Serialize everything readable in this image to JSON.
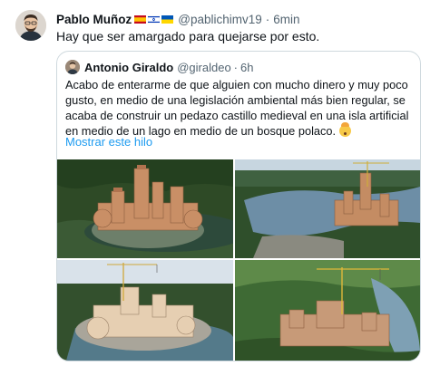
{
  "tweet": {
    "author_name": "Pablo Muñoz",
    "flags": [
      "spain-flag",
      "israel-flag",
      "ukraine-flag"
    ],
    "handle": "@pablichimv19",
    "separator": "·",
    "time": "6min",
    "text": "Hay que ser amargado para quejarse por esto."
  },
  "quote": {
    "author_name": "Antonio Giraldo",
    "handle": "@giraldeo",
    "separator": "·",
    "time": "6h",
    "text": "Acabo de enterarme de que alguien con mucho dinero y muy poco gusto, en medio de una legislación ambiental más bien regular, se acaba de construir un pedazo castillo medieval en una isla artificial en medio de un lago en medio de un bosque polaco.",
    "emoji": "exploding-head-emoji",
    "show_thread": "Mostrar este hilo",
    "photos": [
      "castle-photo-aerial-forest",
      "castle-photo-lake-view",
      "castle-photo-construction",
      "castle-photo-crane-forest"
    ]
  },
  "colors": {
    "text": "#0f1419",
    "secondary": "#536471",
    "link": "#1d9bf0",
    "border": "#cfd9de"
  }
}
